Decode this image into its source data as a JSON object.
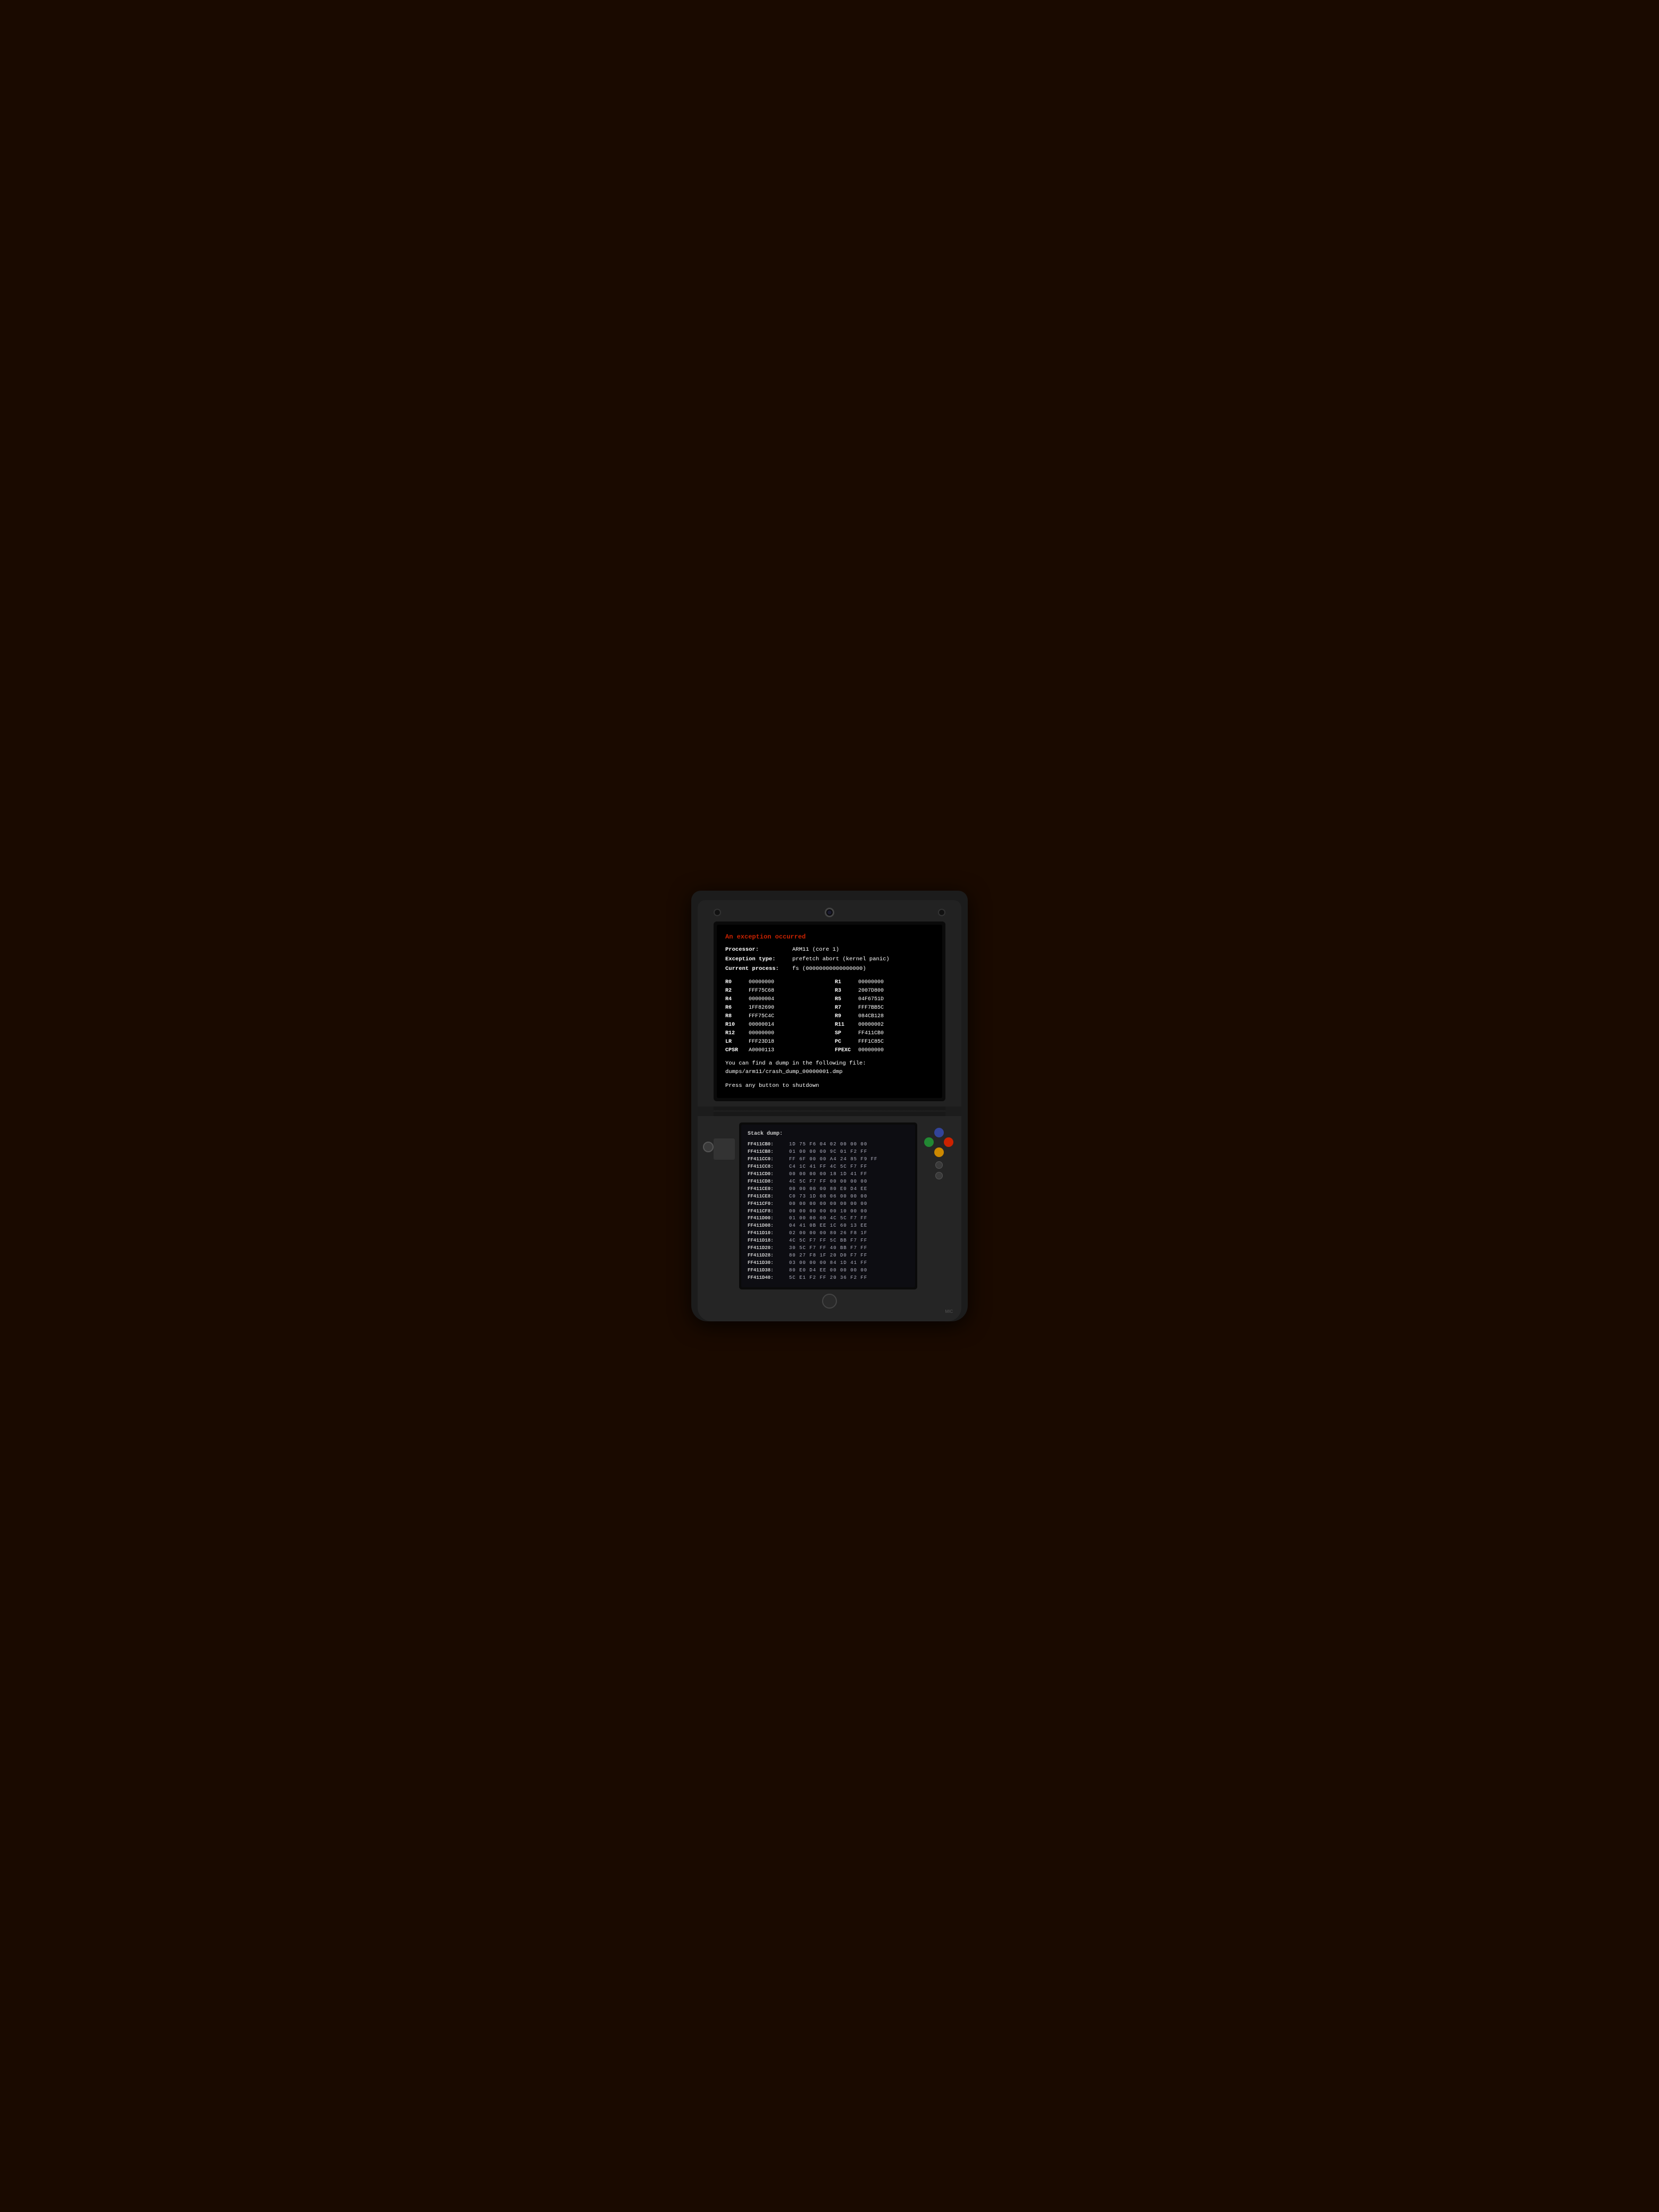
{
  "console": {
    "upper_screen": {
      "error_title": "An exception occurred",
      "processor_label": "Processor:",
      "processor_value": "ARM11 (core 1)",
      "exception_label": "Exception type:",
      "exception_value": "prefetch abort (kernel panic)",
      "process_label": "Current process:",
      "process_value": "fs (00000000000000000)",
      "registers": [
        {
          "name": "R0",
          "value": "00000000",
          "pair_name": "R1",
          "pair_value": "00000000"
        },
        {
          "name": "R2",
          "value": "FFF75C68",
          "pair_name": "R3",
          "pair_value": "2007D800"
        },
        {
          "name": "R4",
          "value": "00000004",
          "pair_name": "R5",
          "pair_value": "04F6751D"
        },
        {
          "name": "R6",
          "value": "1FF82690",
          "pair_name": "R7",
          "pair_value": "FFF7BB5C"
        },
        {
          "name": "R8",
          "value": "FFF75C4C",
          "pair_name": "R9",
          "pair_value": "084CB128"
        },
        {
          "name": "R10",
          "value": "00000014",
          "pair_name": "R11",
          "pair_value": "00000002"
        },
        {
          "name": "R12",
          "value": "00000000",
          "pair_name": "SP",
          "pair_value": "FF411CB0"
        },
        {
          "name": "LR",
          "value": "FFF23D18",
          "pair_name": "PC",
          "pair_value": "FFF1C85C"
        },
        {
          "name": "CPSR",
          "value": "A0000113",
          "pair_name": "FPEXC",
          "pair_value": "00000000"
        }
      ],
      "dump_text": "You can find a dump in the following file:",
      "dump_path": "dumps/arm11/crash_dump_00000001.dmp",
      "press_text": "Press any button to shutdown"
    },
    "lower_screen": {
      "stack_title": "Stack dump:",
      "rows": [
        {
          "addr": "FF411CB0:",
          "bytes": "1D 75 F6 04  02 00 00 00"
        },
        {
          "addr": "FF411CB8:",
          "bytes": "01 00 00 00  9C 01 F2 FF"
        },
        {
          "addr": "FF411CC0:",
          "bytes": "FF 6F 00 00  A4 24 85 F9 FF"
        },
        {
          "addr": "FF411CC8:",
          "bytes": "C4 1C 41 FF  4C 5C F7 FF"
        },
        {
          "addr": "FF411CD0:",
          "bytes": "00 00 00 00  18 1D 41 FF"
        },
        {
          "addr": "FF411CD8:",
          "bytes": "4C 5C F7 FF  00 00 00 00"
        },
        {
          "addr": "FF411CE0:",
          "bytes": "00 00 00 00  80 E0 D4 EE"
        },
        {
          "addr": "FF411CE8:",
          "bytes": "C0 73 1D 08  06 00 00 00"
        },
        {
          "addr": "FF411CF0:",
          "bytes": "00 00 00 00  00 00 00 00"
        },
        {
          "addr": "FF411CF8:",
          "bytes": "00 00 00 00  00 10 00 00"
        },
        {
          "addr": "FF411D00:",
          "bytes": "01 00 00 00  4C 5C F7 FF"
        },
        {
          "addr": "FF411D08:",
          "bytes": "04 41 0B EE  1C 60 13 EE"
        },
        {
          "addr": "FF411D10:",
          "bytes": "02 00 00 00  80 26 F8 1F"
        },
        {
          "addr": "FF411D18:",
          "bytes": "4C 5C F7 FF  5C BB F7 FF"
        },
        {
          "addr": "FF411D20:",
          "bytes": "30 5C F7 FF  40 BB F7 FF"
        },
        {
          "addr": "FF411D28:",
          "bytes": "80 27 F8 1F  20 D0 F7 FF"
        },
        {
          "addr": "FF411D30:",
          "bytes": "03 00 00 00  84 1D 41 FF"
        },
        {
          "addr": "FF411D38:",
          "bytes": "80 E0 D4 EE  00 00 00 00"
        },
        {
          "addr": "FF411D40:",
          "bytes": "5C E1 F2 FF  20 36 F2 FF"
        }
      ]
    }
  }
}
